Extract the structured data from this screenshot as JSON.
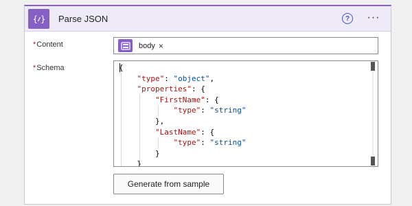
{
  "header": {
    "title": "Parse JSON",
    "action_icon_glyph": "{⁄}",
    "help_glyph": "?",
    "more_glyph": "···",
    "accent_color": "#8661c5"
  },
  "content_field": {
    "required_mark": "*",
    "label": "Content",
    "token": {
      "label": "body",
      "close_glyph": "×",
      "icon": "trigger-icon"
    }
  },
  "schema_field": {
    "required_mark": "*",
    "label": "Schema",
    "lines": [
      "{",
      "    \"type\": \"object\",",
      "    \"properties\": {",
      "        \"FirstName\": {",
      "            \"type\": \"string\"",
      "        },",
      "        \"LastName\": {",
      "            \"type\": \"string\"",
      "        }",
      "    }"
    ]
  },
  "generate_button": {
    "label": "Generate from sample"
  }
}
